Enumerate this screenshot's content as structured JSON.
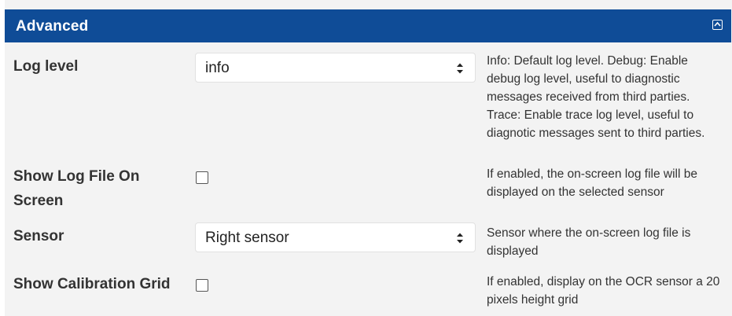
{
  "section": {
    "title": "Advanced",
    "collapse_icon": "collapse-up-icon"
  },
  "rows": {
    "log_level": {
      "label": "Log level",
      "value": "info",
      "help": "Info: Default log level. Debug: Enable debug log level, useful to diagnostic messages received from third parties. Trace: Enable trace log level, useful to diagnotic messages sent to third parties."
    },
    "show_log_file": {
      "label": "Show Log File On Screen",
      "checked": false,
      "help": "If enabled, the on-screen log file will be displayed on the selected sensor"
    },
    "sensor": {
      "label": "Sensor",
      "value": "Right sensor",
      "help": "Sensor where the on-screen log file is displayed"
    },
    "show_calibration_grid": {
      "label": "Show Calibration Grid",
      "checked": false,
      "help": "If enabled, display on the OCR sensor a 20 pixels height grid"
    }
  },
  "colors": {
    "header_bg": "#0f4c97",
    "panel_bg": "#f3f3f3"
  }
}
